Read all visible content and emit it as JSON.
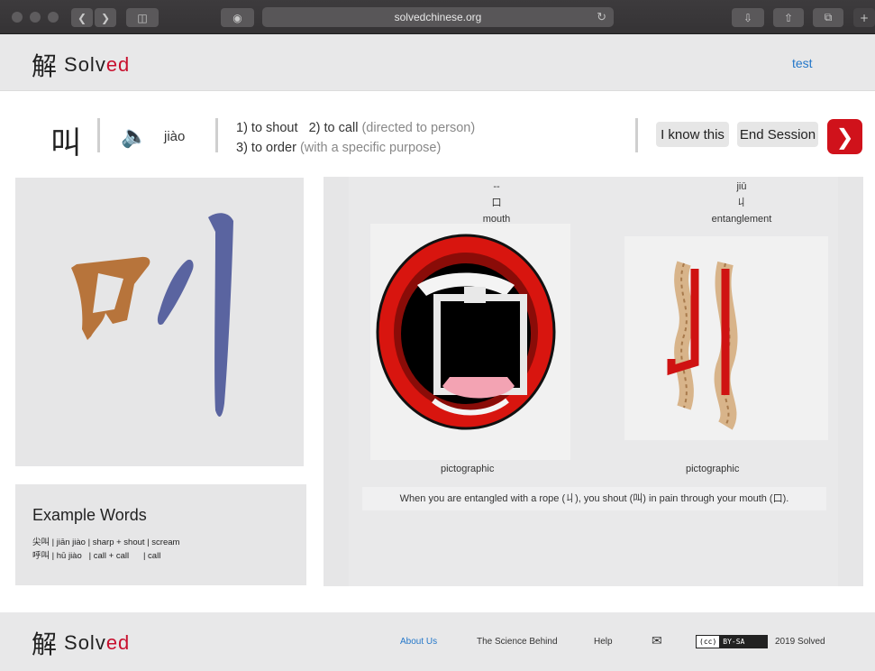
{
  "browser": {
    "url": "solvedchinese.org"
  },
  "header": {
    "logo_glyph": "解",
    "logo_text_main": "Solv",
    "logo_text_accent": "ed",
    "user_link": "test"
  },
  "character": {
    "hanzi": "叫",
    "pinyin": "jiào",
    "definition_line1_a": "1) to shout",
    "definition_line1_b": "2) to call",
    "definition_line1_b_note": "(directed to person)",
    "definition_line2_a": "3) to order",
    "definition_line2_note": "(with a specific purpose)"
  },
  "actions": {
    "know_label": "I know this",
    "end_label": "End Session",
    "next_icon": "chevron-right-icon"
  },
  "examples": {
    "title": "Example Words",
    "rows": [
      "尖叫 | jiān jiào | sharp + shout | scream",
      "呼叫 | hū jiào   | call + call      | call"
    ]
  },
  "components": [
    {
      "pinyin": "--",
      "glyph": "口",
      "meaning": "mouth",
      "type": "pictographic"
    },
    {
      "pinyin": "jiū",
      "glyph": "丩",
      "meaning": "entanglement",
      "type": "pictographic"
    }
  ],
  "story": "When you are entangled with a rope (丩), you shout (叫) in pain through your mouth (口).",
  "footer": {
    "logo_glyph": "解",
    "logo_text_main": "Solv",
    "logo_text_accent": "ed",
    "about": "About Us",
    "science": "The Science Behind",
    "help": "Help",
    "license_cc": "(cc)",
    "license": "BY-SA",
    "copyright": "2019 Solved"
  },
  "colors": {
    "accent_red": "#c8102e",
    "link_blue": "#2477c9",
    "stroke_brown": "#b7743b",
    "stroke_blue": "#5a64a0"
  }
}
